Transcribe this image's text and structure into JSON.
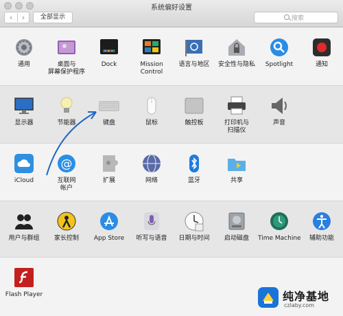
{
  "window": {
    "title": "系统偏好设置"
  },
  "toolbar": {
    "back": "‹",
    "forward": "›",
    "show_all": "全部显示",
    "search_placeholder": "搜索"
  },
  "rows": [
    {
      "shade": "light",
      "items": [
        {
          "id": "general",
          "label": "通用",
          "icon": "gear-icon"
        },
        {
          "id": "desktop",
          "label": "桌面与\n屏幕保护程序",
          "icon": "desktop-icon"
        },
        {
          "id": "dock",
          "label": "Dock",
          "icon": "dock-icon"
        },
        {
          "id": "mission-control",
          "label": "Mission\nControl",
          "icon": "mission-control-icon"
        },
        {
          "id": "language",
          "label": "语言与地区",
          "icon": "flag-icon"
        },
        {
          "id": "security",
          "label": "安全性与隐私",
          "icon": "house-lock-icon"
        },
        {
          "id": "spotlight",
          "label": "Spotlight",
          "icon": "magnifier-icon"
        },
        {
          "id": "notifications",
          "label": "通知",
          "icon": "notification-icon"
        }
      ]
    },
    {
      "shade": "dark",
      "items": [
        {
          "id": "displays",
          "label": "显示器",
          "icon": "monitor-icon"
        },
        {
          "id": "energy",
          "label": "节能器",
          "icon": "lightbulb-icon"
        },
        {
          "id": "keyboard",
          "label": "键盘",
          "icon": "keyboard-icon"
        },
        {
          "id": "mouse",
          "label": "鼠标",
          "icon": "mouse-icon"
        },
        {
          "id": "trackpad",
          "label": "触控板",
          "icon": "trackpad-icon"
        },
        {
          "id": "printers",
          "label": "打印机与\n扫描仪",
          "icon": "printer-icon"
        },
        {
          "id": "sound",
          "label": "声音",
          "icon": "speaker-icon"
        }
      ]
    },
    {
      "shade": "light",
      "items": [
        {
          "id": "icloud",
          "label": "iCloud",
          "icon": "cloud-icon"
        },
        {
          "id": "internet-accounts",
          "label": "互联网\n帐户",
          "icon": "at-sign-icon"
        },
        {
          "id": "extensions",
          "label": "扩展",
          "icon": "puzzle-icon"
        },
        {
          "id": "network",
          "label": "网络",
          "icon": "globe-icon"
        },
        {
          "id": "bluetooth",
          "label": "蓝牙",
          "icon": "bluetooth-icon"
        },
        {
          "id": "sharing",
          "label": "共享",
          "icon": "shared-folder-icon"
        }
      ]
    },
    {
      "shade": "dark",
      "items": [
        {
          "id": "users",
          "label": "用户与群组",
          "icon": "users-icon"
        },
        {
          "id": "parental",
          "label": "家长控制",
          "icon": "parental-icon"
        },
        {
          "id": "appstore",
          "label": "App Store",
          "icon": "appstore-icon"
        },
        {
          "id": "dictation",
          "label": "听写与语音",
          "icon": "microphone-icon"
        },
        {
          "id": "datetime",
          "label": "日期与时间",
          "icon": "clock-icon"
        },
        {
          "id": "startup",
          "label": "启动磁盘",
          "icon": "disk-icon"
        },
        {
          "id": "timemachine",
          "label": "Time Machine",
          "icon": "time-machine-icon"
        },
        {
          "id": "accessibility",
          "label": "辅助功能",
          "icon": "accessibility-icon"
        }
      ]
    },
    {
      "shade": "light",
      "items": [
        {
          "id": "flash",
          "label": "Flash Player",
          "icon": "flash-icon"
        }
      ]
    }
  ],
  "watermark": {
    "text": "纯净基地",
    "url": "czlaby.com"
  },
  "colors": {
    "accent_blue": "#1a73d9",
    "arrow": "#1f66c2"
  }
}
